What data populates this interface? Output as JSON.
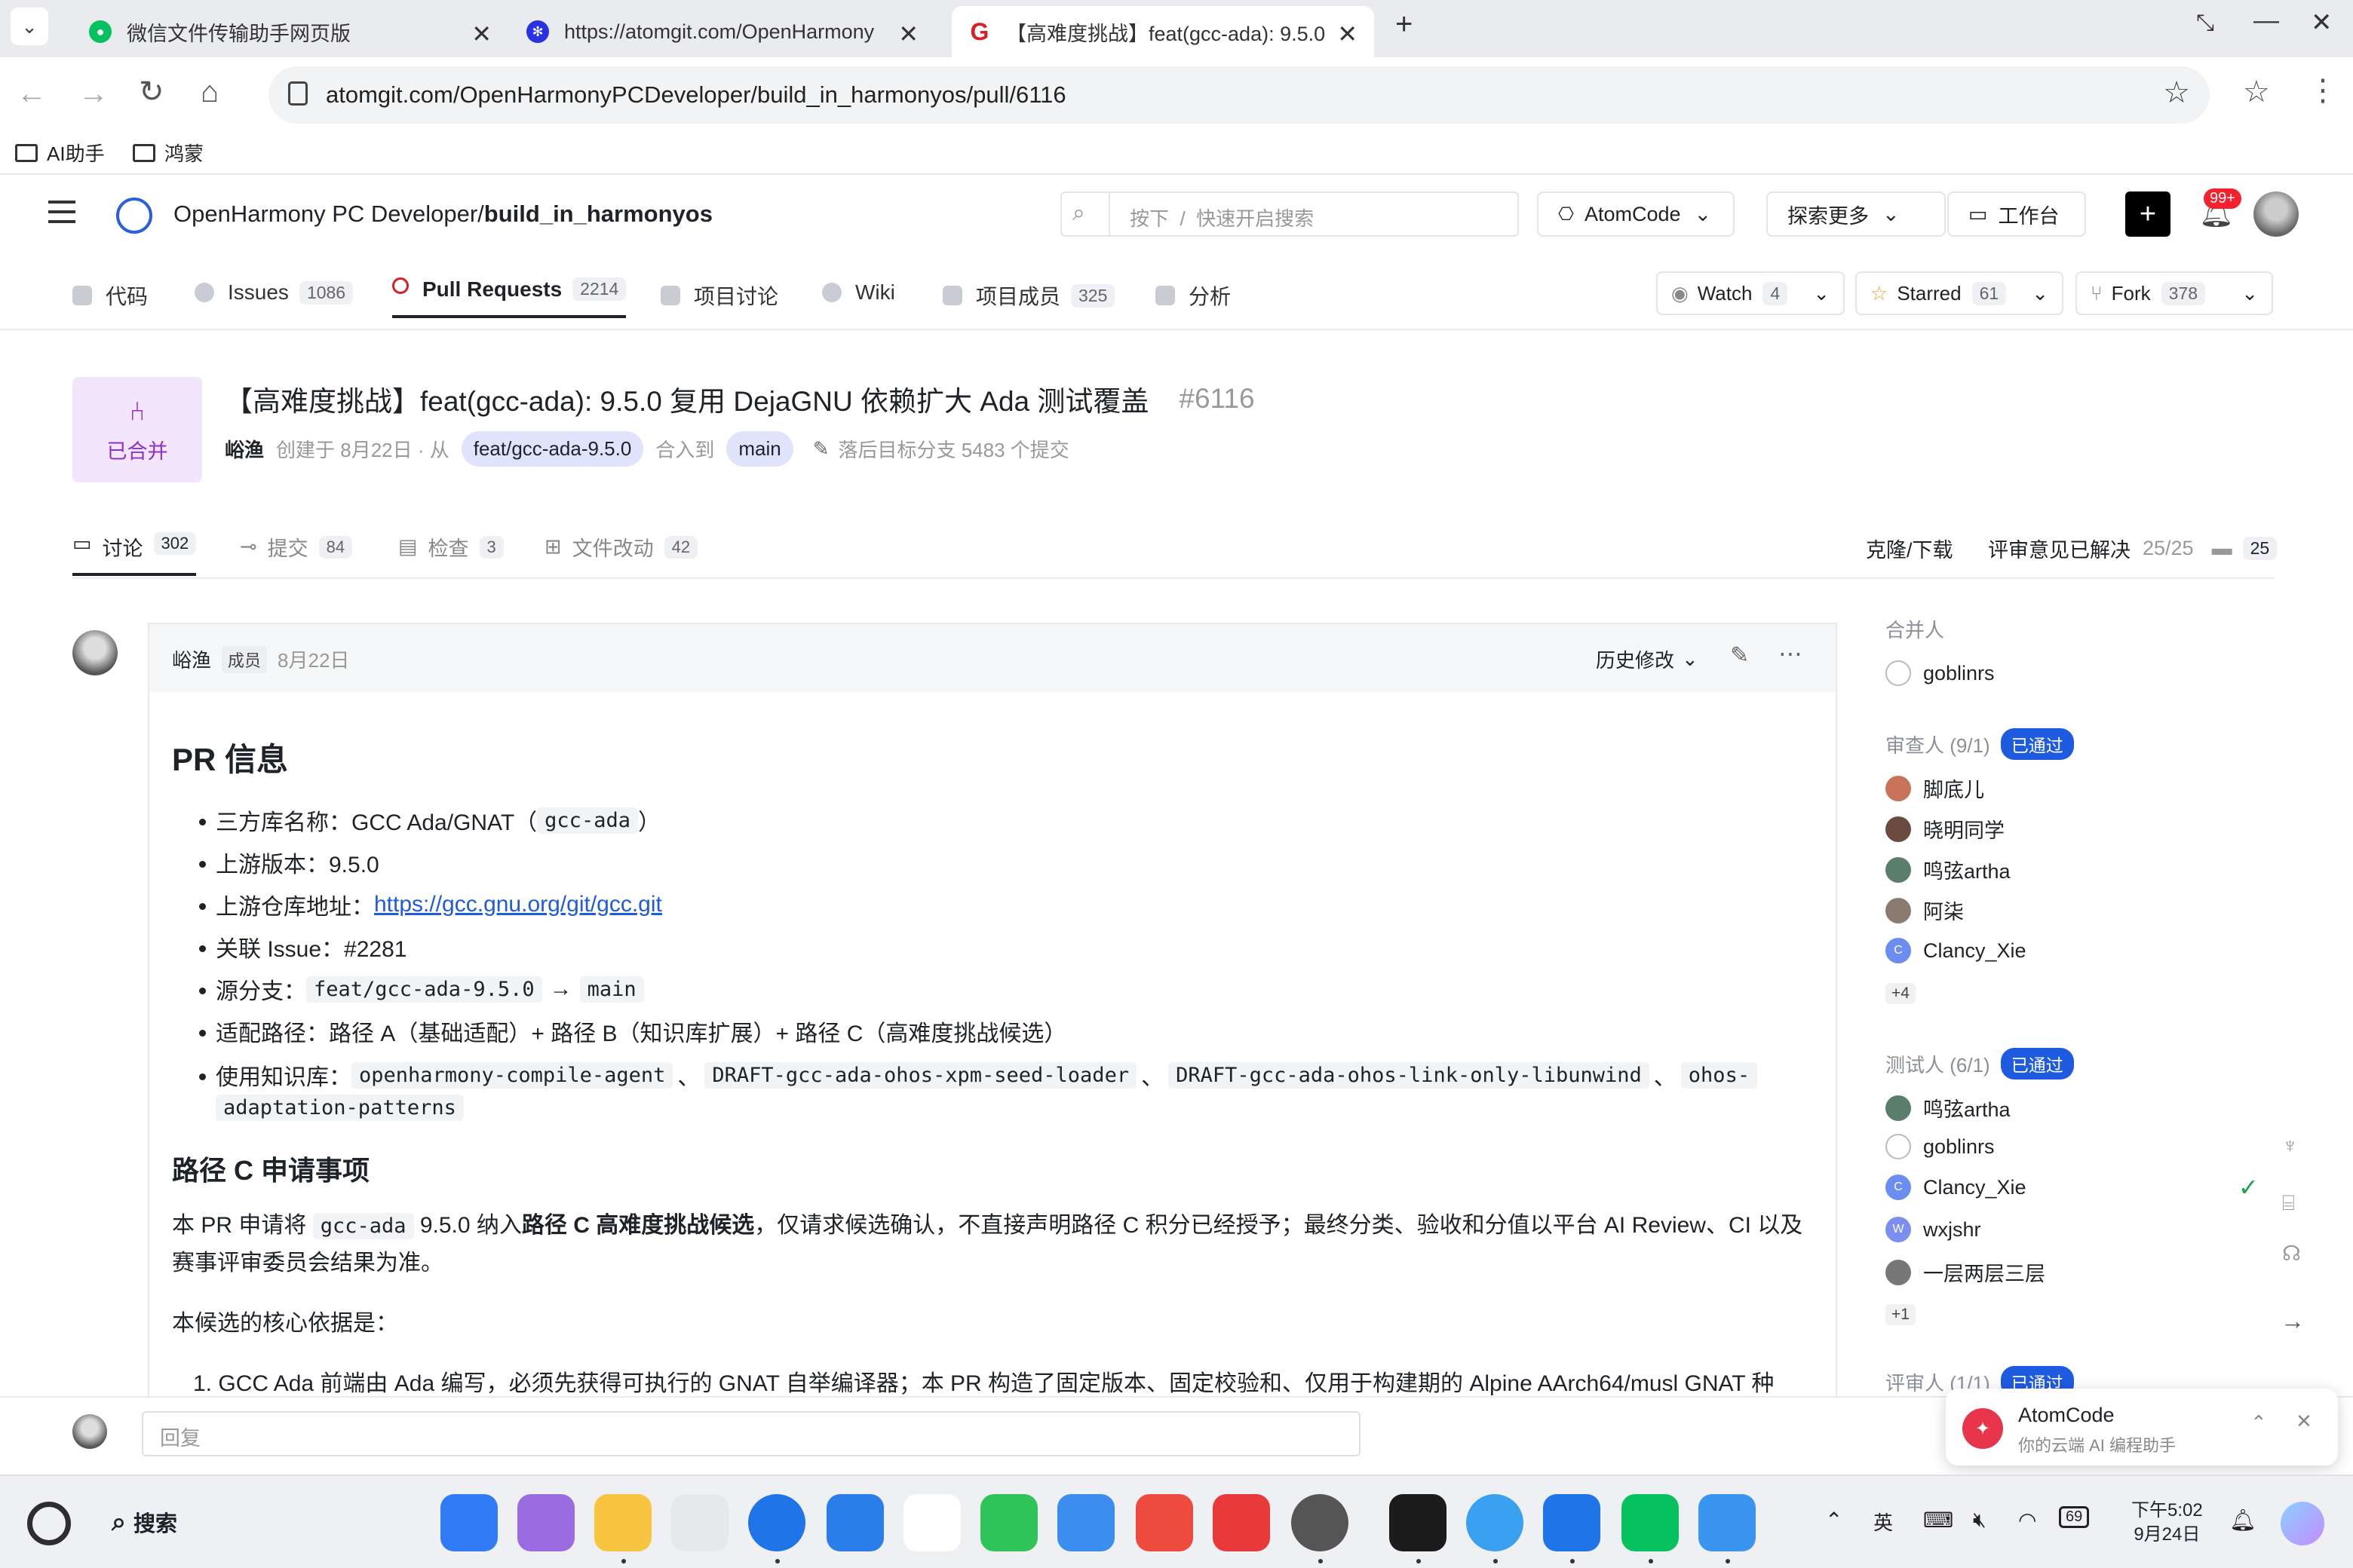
{
  "browser": {
    "tabs": [
      {
        "title": "微信文件传输助手网页版",
        "icon": "wechat-icon",
        "color": "#07c160"
      },
      {
        "title": "https://atomgit.com/OpenHarmony",
        "icon": "paw-icon",
        "color": "#2932e1"
      },
      {
        "title": "【高难度挑战】feat(gcc-ada): 9.5.0",
        "icon": "atomgit-g-icon",
        "color": "#d91f26"
      }
    ],
    "new_tab": "+",
    "url": "atomgit.com/OpenHarmonyPCDeveloper/build_in_harmonyos/pull/6116",
    "bookmarks": [
      "AI助手",
      "鸿蒙"
    ]
  },
  "site": {
    "org": "OpenHarmony PC Developer/",
    "repo": "build_in_harmonyos",
    "search_placeholder": "按下  /  快速开启搜索",
    "atomcode": "AtomCode",
    "explore": "探索更多",
    "workbench": "工作台",
    "notif_count": "99+",
    "nav": [
      {
        "label": "代码",
        "count": ""
      },
      {
        "label": "Issues",
        "count": "1086"
      },
      {
        "label": "Pull Requests",
        "count": "2214"
      },
      {
        "label": "项目讨论",
        "count": ""
      },
      {
        "label": "Wiki",
        "count": ""
      },
      {
        "label": "项目成员",
        "count": "325"
      },
      {
        "label": "分析",
        "count": ""
      }
    ],
    "watch": {
      "label": "Watch",
      "count": "4"
    },
    "starred": {
      "label": "Starred",
      "count": "61"
    },
    "fork": {
      "label": "Fork",
      "count": "378"
    }
  },
  "pr": {
    "status": "已合并",
    "title": "【高难度挑战】feat(gcc-ada): 9.5.0 复用 DejaGNU 依赖扩大 Ada 测试覆盖",
    "number": "#6116",
    "author": "峪渔",
    "created": "创建于 8月22日 · 从",
    "source_branch": "feat/gcc-ada-9.5.0",
    "merge_into": "合入到",
    "target_branch": "main",
    "behind": "落后目标分支 5483 个提交",
    "tabs": [
      {
        "label": "讨论",
        "count": "302"
      },
      {
        "label": "提交",
        "count": "84"
      },
      {
        "label": "检查",
        "count": "3"
      },
      {
        "label": "文件改动",
        "count": "42"
      }
    ],
    "clone": "克隆/下载",
    "resolved_label": "评审意见已解决",
    "resolved_value": "25/25",
    "comments_count": "25"
  },
  "comment": {
    "author": "峪渔",
    "role": "成员",
    "date": "8月22日",
    "history": "历史修改",
    "h2": "PR 信息",
    "items": {
      "lib_label": "三方库名称：GCC Ada/GNAT（",
      "lib_code": "gcc-ada",
      "lib_close": "）",
      "version": "上游版本：9.5.0",
      "repo_label": "上游仓库地址：",
      "repo_link": "https://gcc.gnu.org/git/gcc.git",
      "issue": "关联 Issue：#2281",
      "branch_label": "源分支：",
      "branch_from": "feat/gcc-ada-9.5.0",
      "arrow": "→",
      "branch_to": "main",
      "path": "适配路径：路径 A（基础适配）+ 路径 B（知识库扩展）+ 路径 C（高难度挑战候选）",
      "kb_label": "使用知识库：",
      "kb1": "openharmony-compile-agent",
      "kb2": "DRAFT-gcc-ada-ohos-xpm-seed-loader",
      "kb3": "DRAFT-gcc-ada-ohos-link-only-libunwind",
      "kb4a": "ohos-",
      "kb4b": "adaptation-patterns",
      "sep": "、"
    },
    "h3": "路径 C 申请事项",
    "para1_a": "本 PR 申请将",
    "para1_code": "gcc-ada",
    "para1_b": "9.5.0 纳入",
    "para1_bold": "路径 C 高难度挑战候选",
    "para1_c": "，仅请求候选确认，不直接声明路径 C 积分已经授予；最终分类、验收和分值以平台 AI Review、CI 以及",
    "para1_d": "赛事评审委员会结果为准。",
    "para2": "本候选的核心依据是：",
    "ol1": "1. GCC Ada 前端由 Ada 编写，必须先获得可执行的 GNAT 自举编译器；本 PR 构造了固定版本、固定校验和、仅用于构建期的 Alpine AArch64/musl GNAT 种"
  },
  "sidebar": {
    "merger_h": "合并人",
    "merger": "goblinrs",
    "reviewer_h": "审查人 (9/1)",
    "reviewer_badge": "已通过",
    "reviewers": [
      "脚底儿",
      "晓明同学",
      "鸣弦artha",
      "阿柒",
      "Clancy_Xie"
    ],
    "reviewer_more": "+4",
    "tester_h": "测试人 (6/1)",
    "tester_badge": "已通过",
    "testers": [
      "鸣弦artha",
      "goblinrs",
      "Clancy_Xie",
      "wxjshr",
      "一层两层三层"
    ],
    "tester_more": "+1",
    "rater_h": "评审人 (1/1)",
    "rater_badge": "已通过"
  },
  "reply": {
    "placeholder": "回复"
  },
  "toast": {
    "title": "AtomCode",
    "subtitle": "你的云端 AI 编程助手"
  },
  "taskbar": {
    "search": "搜索",
    "ime": "英",
    "time": "下午5:02",
    "date": "9月24日",
    "battery": "69"
  }
}
